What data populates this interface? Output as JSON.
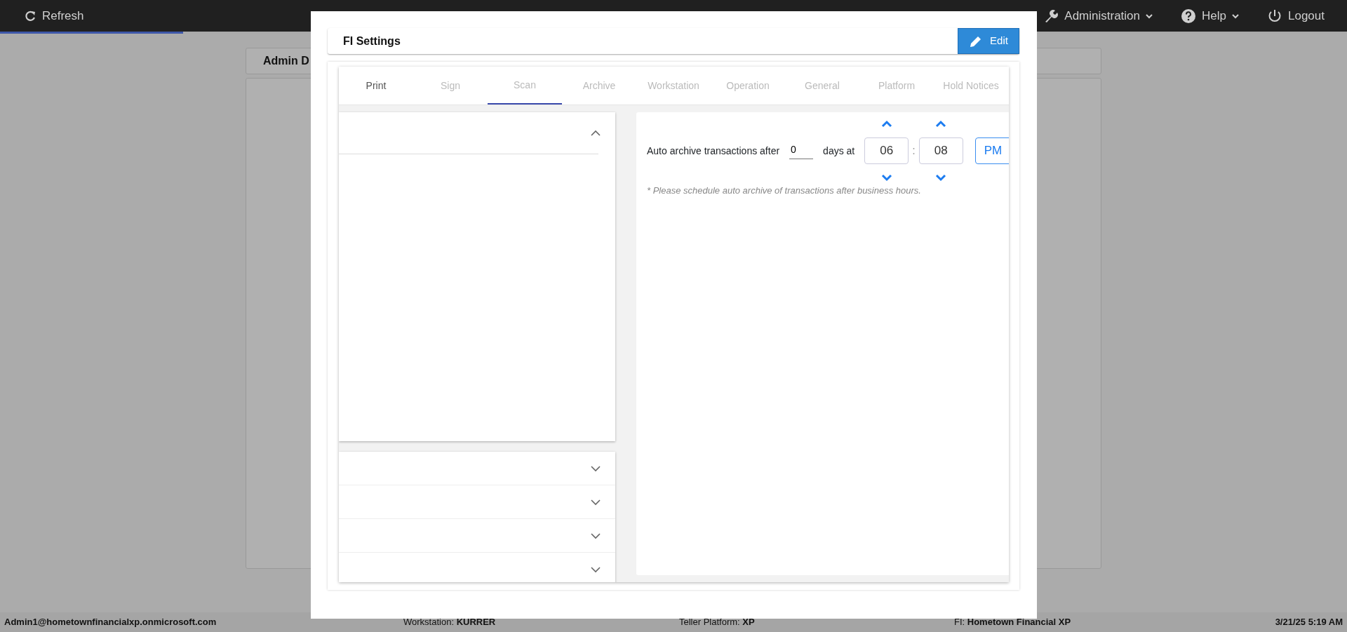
{
  "navbar": {
    "refresh": "Refresh",
    "menus": [
      {
        "label": "Administration",
        "kind": "wrench",
        "dropdown": true
      },
      {
        "label": "Help",
        "kind": "help",
        "dropdown": true
      },
      {
        "label": "Logout",
        "kind": "power",
        "dropdown": false
      }
    ]
  },
  "loading_bar": {
    "level": 0.136
  },
  "background": {
    "card_title": "Admin D"
  },
  "modal": {
    "title": "FI Settings",
    "edit_button": "Edit",
    "tabs": [
      {
        "label": "Print",
        "selected": false,
        "disabled": false
      },
      {
        "label": "Sign",
        "selected": false,
        "disabled": true
      },
      {
        "label": "Scan",
        "selected": true,
        "disabled": true
      },
      {
        "label": "Archive",
        "selected": false,
        "disabled": true
      },
      {
        "label": "Workstation",
        "selected": false,
        "disabled": true
      },
      {
        "label": "Operation",
        "selected": false,
        "disabled": true
      },
      {
        "label": "General",
        "selected": false,
        "disabled": true
      },
      {
        "label": "Platform",
        "selected": false,
        "disabled": true
      },
      {
        "label": "Hold Notices",
        "selected": false,
        "disabled": true
      }
    ],
    "sections": [
      {
        "expanded": true
      },
      {
        "expanded": false
      },
      {
        "expanded": false
      },
      {
        "expanded": false
      },
      {
        "expanded": false
      }
    ],
    "archive": {
      "label_before": "Auto archive transactions after",
      "days": "0",
      "label_after": "days at",
      "hour": "06",
      "separator": ":",
      "minute": "08",
      "meridiem": "PM",
      "note": "* Please schedule auto archive of transactions after business hours."
    }
  },
  "status_bar": {
    "user": "Admin1@hometownfinancialxp.onmicrosoft.com",
    "fields": [
      {
        "label": "Workstation:",
        "value": "KURRER"
      },
      {
        "label": "Teller Platform:",
        "value": "XP"
      },
      {
        "label": "FI:",
        "value": "Hometown Financial XP"
      }
    ],
    "datetime": "3/21/25 5:19 AM"
  }
}
